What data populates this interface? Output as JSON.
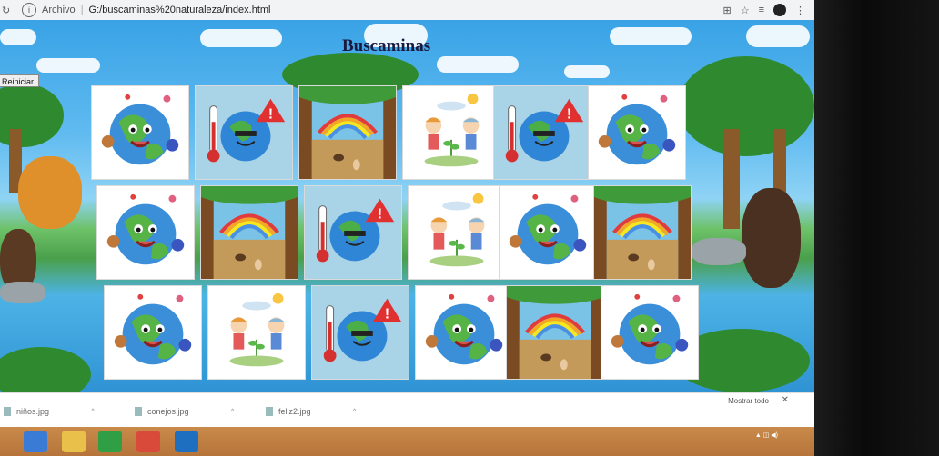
{
  "browser": {
    "protocol": "Archivo",
    "url": "G:/buscaminas%20naturaleza/index.html"
  },
  "game": {
    "title": "Buscaminas",
    "restart_label": "Reiniciar",
    "tiles": [
      [
        "happy-earth",
        "hot-earth-warning",
        "rainbow-forest",
        "kids-planting",
        "hot-earth-warning",
        "happy-earth"
      ],
      [
        "happy-earth",
        "rainbow-forest",
        "hot-earth-warning",
        "kids-planting",
        "happy-earth",
        "rainbow-forest"
      ],
      [
        "happy-earth",
        "kids-planting",
        "hot-earth-warning",
        "happy-earth",
        "rainbow-forest",
        "happy-earth"
      ]
    ]
  },
  "downloads": {
    "items": [
      "niños.jpg",
      "conejos.jpg",
      "feliz2.jpg"
    ],
    "show_all_label": "Mostrar todo",
    "close_icon": "close-icon"
  },
  "colors": {
    "sky": "#39a3e6",
    "grass": "#4aa04a",
    "taskbar": "#c98a4a"
  }
}
